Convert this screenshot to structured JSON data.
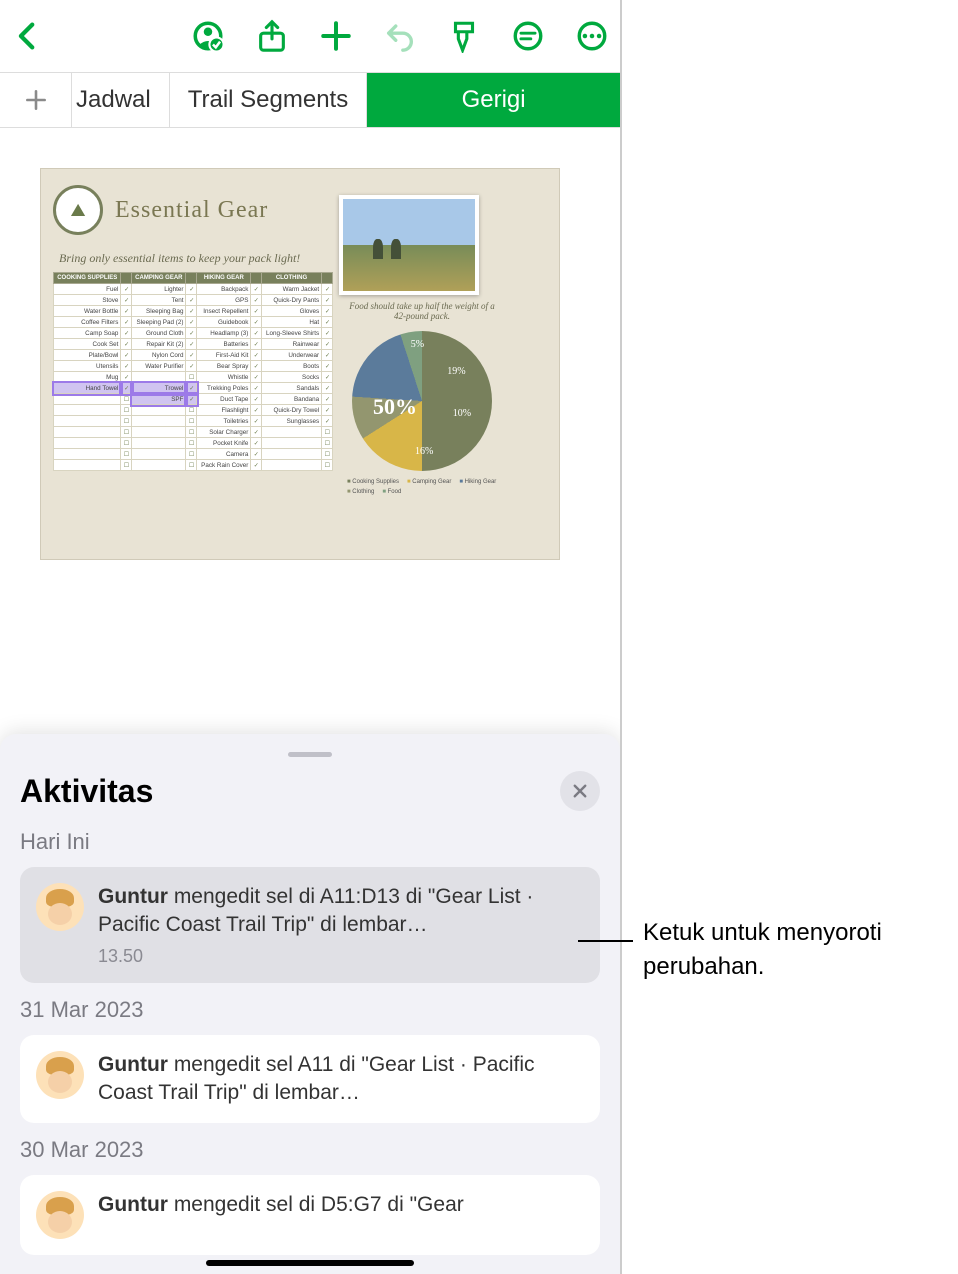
{
  "toolbar": {
    "back": "back",
    "collab": "collaborate",
    "share": "share",
    "add": "add",
    "undo": "undo",
    "format": "format-brush",
    "insert": "insert",
    "more": "more"
  },
  "tabs": {
    "t1": "Jadwal",
    "t2": "Trail Segments",
    "t3": "Gerigi"
  },
  "sheet": {
    "title": "Essential Gear",
    "subtitle": "Bring only essential items to keep your pack light!",
    "headers": [
      "COOKING SUPPLIES",
      "CAMPING GEAR",
      "HIKING GEAR",
      "CLOTHING"
    ],
    "rows": [
      [
        "Fuel",
        "Lighter",
        "Backpack",
        "Warm Jacket"
      ],
      [
        "Stove",
        "Tent",
        "GPS",
        "Quick-Dry Pants"
      ],
      [
        "Water Bottle",
        "Sleeping Bag",
        "Insect Repellent",
        "Gloves"
      ],
      [
        "Coffee Filters",
        "Sleeping Pad (2)",
        "Guidebook",
        "Hat"
      ],
      [
        "Camp Soap",
        "Ground Cloth",
        "Headlamp (3)",
        "Long-Sleeve Shirts"
      ],
      [
        "Cook Set",
        "Repair Kit (2)",
        "Batteries",
        "Rainwear"
      ],
      [
        "Plate/Bowl",
        "Nylon Cord",
        "First-Aid Kit",
        "Underwear"
      ],
      [
        "Utensils",
        "Water Purifier",
        "Bear Spray",
        "Boots"
      ],
      [
        "Mug",
        "",
        "Whistle",
        "Socks"
      ],
      [
        "Hand Towel",
        "Trowel",
        "Trekking Poles",
        "Sandals"
      ],
      [
        "",
        "SPF",
        "Duct Tape",
        "Bandana"
      ],
      [
        "",
        "",
        "Flashlight",
        "Quick-Dry Towel"
      ],
      [
        "",
        "",
        "Toiletries",
        "Sunglasses"
      ],
      [
        "",
        "",
        "Solar Charger",
        ""
      ],
      [
        "",
        "",
        "Pocket Knife",
        ""
      ],
      [
        "",
        "",
        "Camera",
        ""
      ],
      [
        "",
        "",
        "Pack Rain Cover",
        ""
      ]
    ],
    "caption": "Food should take up half the weight of a 42-pound pack.",
    "legend": [
      "Cooking Supplies",
      "Camping Gear",
      "Hiking Gear",
      "Clothing",
      "Food"
    ]
  },
  "chart_data": {
    "type": "pie",
    "title": "",
    "slices": [
      {
        "label": "Food",
        "value": 50
      },
      {
        "label": "Clothing",
        "value": 16
      },
      {
        "label": "Hiking Gear",
        "value": 10
      },
      {
        "label": "Camping Gear",
        "value": 19
      },
      {
        "label": "Cooking Supplies",
        "value": 5
      }
    ],
    "labels": {
      "p50": "50%",
      "p16": "16%",
      "p10": "10%",
      "p19": "19%",
      "p5": "5%"
    }
  },
  "activity": {
    "title": "Aktivitas",
    "today": "Hari Ini",
    "date1": "31 Mar 2023",
    "date2": "30 Mar 2023",
    "card1": {
      "user": "Guntur",
      "text": " mengedit sel di A11:D13 di \"Gear List · Pacific Coast Trail Trip\" di lembar…",
      "time": "13.50"
    },
    "card2": {
      "user": "Guntur",
      "text": " mengedit sel A11 di \"Gear List · Pacific Coast Trail Trip\" di lembar…"
    },
    "card3": {
      "user": "Guntur",
      "text": " mengedit sel di D5:G7 di \"Gear"
    }
  },
  "callout": "Ketuk untuk menyoroti perubahan."
}
